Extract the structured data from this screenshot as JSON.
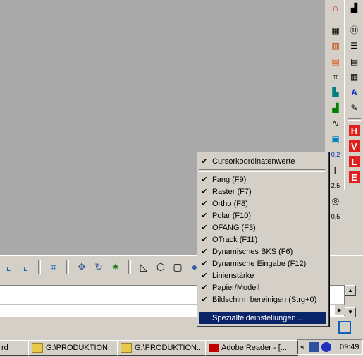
{
  "menu": {
    "items": [
      {
        "label": "Cursorkoordinatenwerte",
        "checked": true
      },
      {
        "label": "Fang (F9)",
        "checked": true
      },
      {
        "label": "Raster (F7)",
        "checked": true
      },
      {
        "label": "Ortho (F8)",
        "checked": true
      },
      {
        "label": "Polar (F10)",
        "checked": true
      },
      {
        "label": "OFANG (F3)",
        "checked": true
      },
      {
        "label": "OTrack (F11)",
        "checked": true
      },
      {
        "label": "Dynamisches BKS (F6)",
        "checked": true
      },
      {
        "label": "Dynamische Eingabe (F12)",
        "checked": true
      },
      {
        "label": "Linienstärke",
        "checked": true
      },
      {
        "label": "Papier/Modell",
        "checked": true
      },
      {
        "label": "Bildschirm bereinigen (Strg+0)",
        "checked": true
      },
      {
        "label": "Spezialfeldeinstellungen...",
        "checked": false
      }
    ],
    "check_glyph": "✔"
  },
  "taskbar": {
    "tasks": [
      {
        "label": "rd",
        "icon": "word-icon"
      },
      {
        "label": "G:\\PRODUKTION...",
        "icon": "folder-icon"
      },
      {
        "label": "G:\\PRODUKTION...",
        "icon": "folder-icon"
      },
      {
        "label": "Adobe Reader - [...",
        "icon": "adobe-reader-icon"
      }
    ],
    "tray_expand": "«",
    "clock": "09:49"
  },
  "right_toolbar": {
    "labels": {
      "dim_small": "0,2",
      "scale": "2,5",
      "lweight": "0,5"
    },
    "red_buttons": [
      "H",
      "V",
      "L",
      "E"
    ]
  },
  "colors": {
    "canvas": "#a9a9a9",
    "chrome": "#d4d0c8",
    "highlight": "#0a246a",
    "red_button": "#e02020"
  }
}
